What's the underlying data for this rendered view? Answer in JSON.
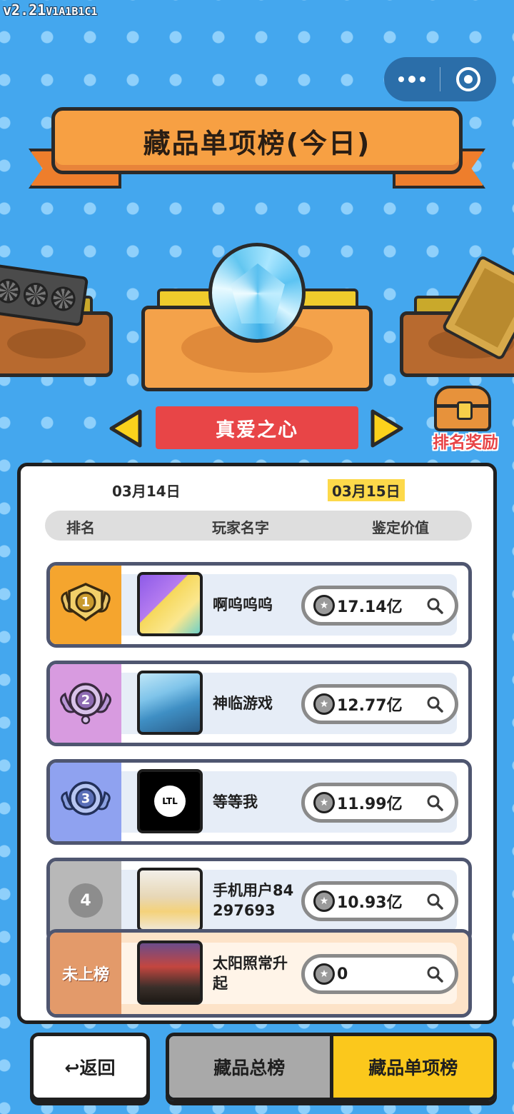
{
  "version": {
    "main": "v2.21",
    "suffix": "V1A1B1C1"
  },
  "title": "藏品单项榜(今日)",
  "item_name": "真爱之心",
  "reward_label": "排名奖励",
  "dates": [
    "03月14日",
    "03月15日"
  ],
  "selected_date_index": 1,
  "columns": {
    "rank": "排名",
    "name": "玩家名字",
    "value": "鉴定价值"
  },
  "rows": [
    {
      "rank": "1",
      "name": "啊呜呜呜",
      "value": "17.14亿",
      "color": "#f5a52e"
    },
    {
      "rank": "2",
      "name": "神临游戏",
      "value": "12.77亿",
      "color": "#d89be0"
    },
    {
      "rank": "3",
      "name": "等等我",
      "value": "11.99亿",
      "color": "#8fa2f0"
    },
    {
      "rank": "4",
      "name": "手机用户84297693",
      "value": "10.93亿",
      "color": "#b8b8b8"
    }
  ],
  "self_row": {
    "rank": "未上榜",
    "name": "太阳照常升起",
    "value": "0",
    "color": "#e39a6a"
  },
  "avatar_3_text": "LTL",
  "back_label": "↩返回",
  "tabs": [
    {
      "label": "藏品总榜",
      "active": false
    },
    {
      "label": "藏品单项榜",
      "active": true
    }
  ]
}
